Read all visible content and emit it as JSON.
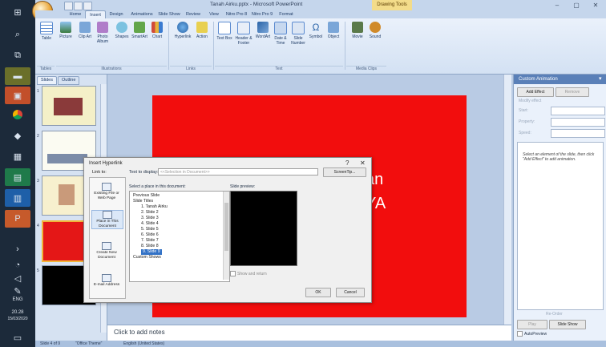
{
  "window": {
    "title": "Tanah Airku.pptx - Microsoft PowerPoint",
    "context_tab": "Drawing Tools"
  },
  "taskbar": {
    "lang": "ENG",
    "time": "20.28",
    "date": "15/03/2020"
  },
  "tabs": [
    "Home",
    "Insert",
    "Design",
    "Animations",
    "Slide Show",
    "Review",
    "View",
    "Nitro Pro 8",
    "Nitro Pro 9",
    "Format"
  ],
  "ribbon": {
    "buttons": [
      {
        "label": "Table"
      },
      {
        "label": "Picture"
      },
      {
        "label": "Clip Art"
      },
      {
        "label": "Photo Album"
      },
      {
        "label": "Shapes"
      },
      {
        "label": "SmartArt"
      },
      {
        "label": "Chart"
      },
      {
        "label": "Hyperlink"
      },
      {
        "label": "Action"
      },
      {
        "label": "Text Box"
      },
      {
        "label": "Header & Footer"
      },
      {
        "label": "WordArt"
      },
      {
        "label": "Date & Time"
      },
      {
        "label": "Slide Number"
      },
      {
        "label": "Symbol"
      },
      {
        "label": "Object"
      },
      {
        "label": "Movie"
      },
      {
        "label": "Sound"
      }
    ],
    "groups": [
      "Tables",
      "Illustrations",
      "Links",
      "Text",
      "Media Clips"
    ]
  },
  "slides_panel": {
    "tabs": [
      "Slides",
      "Outline"
    ],
    "thumb_numbers": [
      "1",
      "2",
      "3",
      "4",
      "5"
    ]
  },
  "slide": {
    "text_line1": "an",
    "text_line2": "YA"
  },
  "notes": {
    "placeholder": "Click to add notes"
  },
  "task_pane": {
    "title": "Custom Animation",
    "add_effect": "Add Effect",
    "remove": "Remove",
    "modify": "Modify effect",
    "start_label": "Start:",
    "property_label": "Property:",
    "speed_label": "Speed:",
    "hint": "Select an element of the slide, then click \"Add Effect\" to add animation.",
    "re_order": "Re-Order",
    "play": "Play",
    "slide_show": "Slide Show",
    "autopreview": "AutoPreview"
  },
  "dialog": {
    "title": "Insert Hyperlink",
    "help": "?",
    "close": "✕",
    "link_to_label": "Link to:",
    "link_to_items": [
      "Existing File or Web Page",
      "Place in This Document",
      "Create New Document",
      "E-mail Address"
    ],
    "text_to_display_label": "Text to display:",
    "text_to_display_value": "<<Selection in Document>>",
    "screentip_label": "ScreenTip...",
    "select_place_label": "Select a place in this document:",
    "tree": [
      "Previous Slide",
      "Slide Titles",
      "1. Tanah Airku",
      "2. Slide 2",
      "3. Slide 3",
      "4. Slide 4",
      "5. Slide 5",
      "6. Slide 6",
      "7. Slide 7",
      "8. Slide 8",
      "9. Slide 9",
      "Custom Shows"
    ],
    "slide_preview_label": "Slide preview:",
    "show_and_return": "Show and return",
    "ok": "OK",
    "cancel": "Cancel"
  },
  "statusbar": {
    "slide_info": "Slide 4 of 9",
    "theme": "\"Office Theme\"",
    "lang": "English (United States)"
  }
}
